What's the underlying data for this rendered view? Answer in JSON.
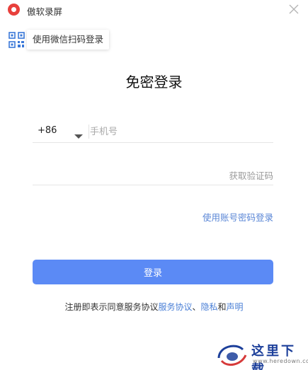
{
  "app": {
    "title": "傲软录屏"
  },
  "qr_login": {
    "label": "使用微信扫码登录"
  },
  "main": {
    "title": "免密登录"
  },
  "phone": {
    "country_code": "+86",
    "placeholder": "手机号",
    "value": ""
  },
  "code": {
    "placeholder": "",
    "value": "",
    "get_code_label": "获取验证码"
  },
  "links": {
    "password_login": "使用账号密码登录"
  },
  "login_button": {
    "label": "登录"
  },
  "agreement": {
    "prefix": "注册即表示同意服务协议",
    "terms": "服务协议",
    "sep": "、",
    "privacy": "隐私",
    "and": "和",
    "statement": "声明"
  },
  "watermark": {
    "text": "这里下载",
    "url": "www.heredown.com"
  },
  "colors": {
    "accent": "#5b8af5",
    "link": "#4a7fd6",
    "logo_red": "#e8403c",
    "watermark_blue": "#1c3f9a"
  },
  "icons": {
    "logo": "record-logo-icon",
    "close": "close-icon",
    "qr": "qr-code-icon",
    "dropdown": "caret-down-icon"
  }
}
